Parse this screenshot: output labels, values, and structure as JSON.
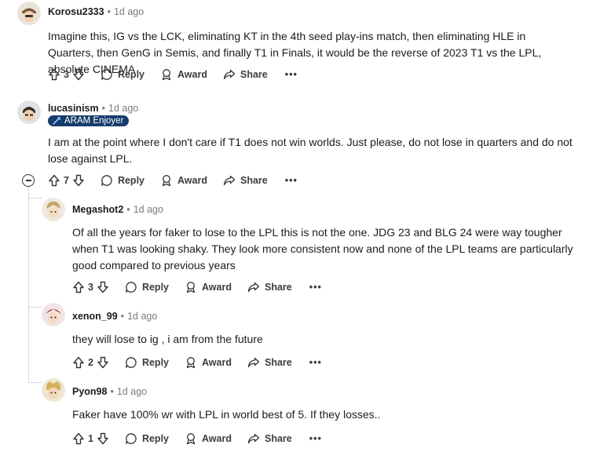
{
  "comments": [
    {
      "username": "Korosu2333",
      "separator": "•",
      "age": "1d ago",
      "body": "Imagine this, IG vs the LCK, eliminating KT in the 4th seed play-ins match, then eliminating HLE in Quarters, then GenG in Semis, and finally T1 in Finals, it would be the reverse of 2023 T1 vs the LPL, absolute CINEMA",
      "votes": "3"
    },
    {
      "username": "lucasinism",
      "separator": "•",
      "age": "1d ago",
      "flair": "ARAM Enjoyer",
      "body": "I am at the point where I don't care if T1 does not win worlds. Just please, do not lose in quarters and do not lose against LPL.",
      "votes": "7"
    },
    {
      "username": "Megashot2",
      "separator": "•",
      "age": "1d ago",
      "body": "Of all the years for faker to lose to the LPL this is not the one. JDG 23 and BLG 24 were way tougher when T1 was looking shaky. They look more consistent now and none of the LPL teams are particularly good compared to previous years",
      "votes": "3"
    },
    {
      "username": "xenon_99",
      "separator": "•",
      "age": "1d ago",
      "body": "they will lose to ig , i am from the future",
      "votes": "2"
    },
    {
      "username": "Pyon98",
      "separator": "•",
      "age": "1d ago",
      "body": "Faker have 100% wr with LPL in world best of 5. If they losses..",
      "votes": "1"
    }
  ],
  "actions": {
    "reply": "Reply",
    "award": "Award",
    "share": "Share",
    "more": "•••"
  },
  "colors": {
    "flair_bg": "#153c6b",
    "thread_line": "#d7dade",
    "meta_gray": "#7c7c7c"
  }
}
